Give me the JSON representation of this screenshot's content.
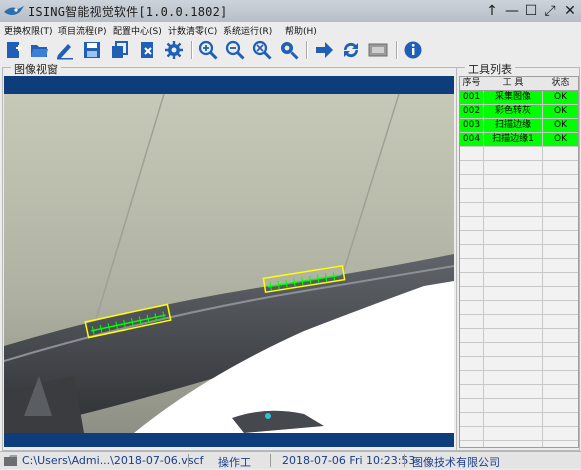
{
  "app": {
    "title": "ISING智能视觉软件[1.0.0.1802]",
    "window_buttons": {
      "pin": "↑",
      "minimize": "—",
      "maximize": "☐",
      "restore": "⤢",
      "close": "✕"
    }
  },
  "menu": [
    {
      "label": "更换权限(T)"
    },
    {
      "label": "项目流程(P)"
    },
    {
      "label": "配置中心(S)"
    },
    {
      "label": "计数清零(C)"
    },
    {
      "label": "系统运行(R)"
    },
    {
      "label": "帮助(H)"
    }
  ],
  "toolbar": {
    "icons": [
      "new-file-icon",
      "open-folder-icon",
      "edit-pencil-icon",
      "save-icon",
      "copy-icon",
      "delete-file-icon",
      "settings-gear-icon",
      "zoom-in-icon",
      "zoom-out-icon",
      "zoom-fit-icon",
      "zoom-reset-icon",
      "run-arrow-icon",
      "cycle-run-icon",
      "camera-trigger-icon",
      "info-icon"
    ]
  },
  "image_view": {
    "title": "图像视窗"
  },
  "tool_list": {
    "title": "工具列表",
    "columns": [
      "序号",
      "工 具",
      "状态"
    ],
    "rows": [
      {
        "id": "001",
        "tool": "采集图像",
        "status": "OK"
      },
      {
        "id": "002",
        "tool": "彩色转灰",
        "status": "OK"
      },
      {
        "id": "003",
        "tool": "扫描边缘",
        "status": "OK"
      },
      {
        "id": "004",
        "tool": "扫描边缘1",
        "status": "OK"
      }
    ]
  },
  "status_bar": {
    "file": "C:\\Users\\Admi...\\2018-07-06.vscf",
    "user": "操作工",
    "datetime": "2018-07-06 Fri 10:23:53",
    "company": "图像技术有限公司"
  },
  "colors": {
    "tool_ok": "#00ff00",
    "image_frame": "#0d3d7a",
    "status_text": "#1a3e8a",
    "edge_box": "#ffff00"
  }
}
